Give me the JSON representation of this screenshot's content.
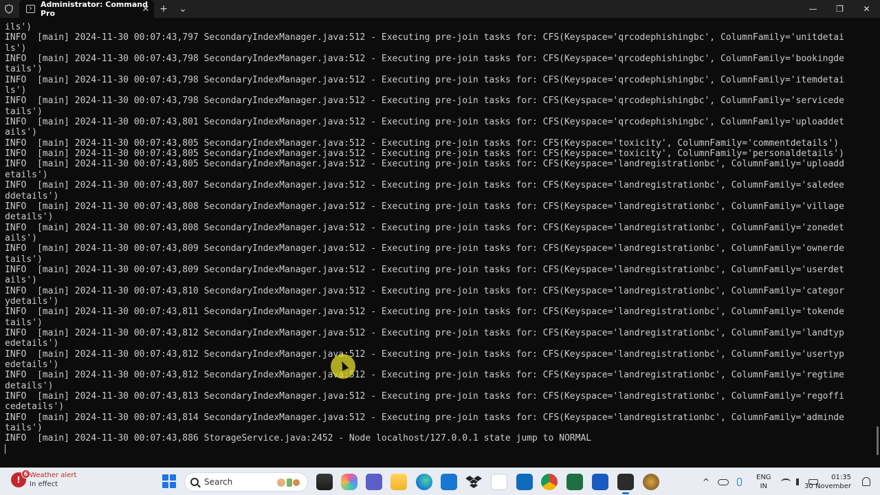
{
  "window": {
    "tab_title": "Administrator: Command Pro",
    "tab_close": "✕",
    "new_tab": "+",
    "dropdown": "⌄",
    "minimize": "—",
    "maximize": "❐",
    "close": "✕"
  },
  "terminal": {
    "lines": [
      "ils')",
      "INFO  [main] 2024-11-30 00:07:43,797 SecondaryIndexManager.java:512 - Executing pre-join tasks for: CFS(Keyspace='qrcodephishingbc', ColumnFamily='unitdetai",
      "ls')",
      "INFO  [main] 2024-11-30 00:07:43,798 SecondaryIndexManager.java:512 - Executing pre-join tasks for: CFS(Keyspace='qrcodephishingbc', ColumnFamily='bookingde",
      "tails')",
      "INFO  [main] 2024-11-30 00:07:43,798 SecondaryIndexManager.java:512 - Executing pre-join tasks for: CFS(Keyspace='qrcodephishingbc', ColumnFamily='itemdetai",
      "ls')",
      "INFO  [main] 2024-11-30 00:07:43,798 SecondaryIndexManager.java:512 - Executing pre-join tasks for: CFS(Keyspace='qrcodephishingbc', ColumnFamily='servicede",
      "tails')",
      "INFO  [main] 2024-11-30 00:07:43,801 SecondaryIndexManager.java:512 - Executing pre-join tasks for: CFS(Keyspace='qrcodephishingbc', ColumnFamily='uploaddet",
      "ails')",
      "INFO  [main] 2024-11-30 00:07:43,805 SecondaryIndexManager.java:512 - Executing pre-join tasks for: CFS(Keyspace='toxicity', ColumnFamily='commentdetails')",
      "INFO  [main] 2024-11-30 00:07:43,805 SecondaryIndexManager.java:512 - Executing pre-join tasks for: CFS(Keyspace='toxicity', ColumnFamily='personaldetails')",
      "INFO  [main] 2024-11-30 00:07:43,805 SecondaryIndexManager.java:512 - Executing pre-join tasks for: CFS(Keyspace='landregistrationbc', ColumnFamily='uploadd",
      "etails')",
      "INFO  [main] 2024-11-30 00:07:43,807 SecondaryIndexManager.java:512 - Executing pre-join tasks for: CFS(Keyspace='landregistrationbc', ColumnFamily='saledee",
      "ddetails')",
      "INFO  [main] 2024-11-30 00:07:43,808 SecondaryIndexManager.java:512 - Executing pre-join tasks for: CFS(Keyspace='landregistrationbc', ColumnFamily='village",
      "details')",
      "INFO  [main] 2024-11-30 00:07:43,808 SecondaryIndexManager.java:512 - Executing pre-join tasks for: CFS(Keyspace='landregistrationbc', ColumnFamily='zonedet",
      "ails')",
      "INFO  [main] 2024-11-30 00:07:43,809 SecondaryIndexManager.java:512 - Executing pre-join tasks for: CFS(Keyspace='landregistrationbc', ColumnFamily='ownerde",
      "tails')",
      "INFO  [main] 2024-11-30 00:07:43,809 SecondaryIndexManager.java:512 - Executing pre-join tasks for: CFS(Keyspace='landregistrationbc', ColumnFamily='userdet",
      "ails')",
      "INFO  [main] 2024-11-30 00:07:43,810 SecondaryIndexManager.java:512 - Executing pre-join tasks for: CFS(Keyspace='landregistrationbc', ColumnFamily='categor",
      "ydetails')",
      "INFO  [main] 2024-11-30 00:07:43,811 SecondaryIndexManager.java:512 - Executing pre-join tasks for: CFS(Keyspace='landregistrationbc', ColumnFamily='tokende",
      "tails')",
      "INFO  [main] 2024-11-30 00:07:43,812 SecondaryIndexManager.java:512 - Executing pre-join tasks for: CFS(Keyspace='landregistrationbc', ColumnFamily='landtyp",
      "edetails')",
      "INFO  [main] 2024-11-30 00:07:43,812 SecondaryIndexManager.java:512 - Executing pre-join tasks for: CFS(Keyspace='landregistrationbc', ColumnFamily='usertyp",
      "edetails')",
      "INFO  [main] 2024-11-30 00:07:43,812 SecondaryIndexManager.java:512 - Executing pre-join tasks for: CFS(Keyspace='landregistrationbc', ColumnFamily='regtime",
      "details')",
      "INFO  [main] 2024-11-30 00:07:43,813 SecondaryIndexManager.java:512 - Executing pre-join tasks for: CFS(Keyspace='landregistrationbc', ColumnFamily='regoffi",
      "cedetails')",
      "INFO  [main] 2024-11-30 00:07:43,814 SecondaryIndexManager.java:512 - Executing pre-join tasks for: CFS(Keyspace='landregistrationbc', ColumnFamily='adminde",
      "tails')",
      "INFO  [main] 2024-11-30 00:07:43,886 StorageService.java:2452 - Node localhost/127.0.0.1 state jump to NORMAL"
    ]
  },
  "taskbar": {
    "weather_title": "Weather alert",
    "weather_subtitle": "In effect",
    "weather_badge": "6",
    "search_placeholder": "Search",
    "lang_line1": "ENG",
    "lang_line2": "IN",
    "time": "01:35",
    "date": "30 November",
    "tray_chevron": "^"
  },
  "colors": {
    "terminal_bg": "#0c0c0c",
    "terminal_fg": "#cccccc",
    "titlebar_bg": "#202020",
    "taskbar_bg": "#e9edf3",
    "accent": "#1e73e8"
  }
}
